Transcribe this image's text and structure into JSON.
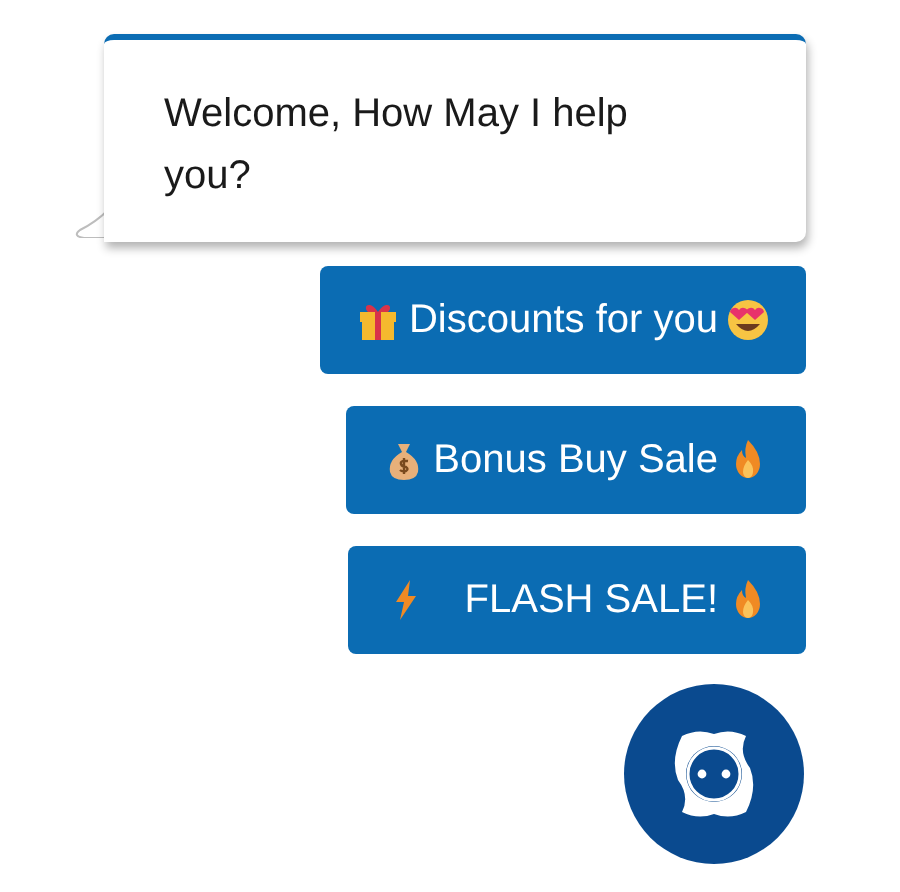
{
  "message": {
    "text": "Welcome, How May I help you?"
  },
  "quick_replies": [
    {
      "label": "Discounts for you",
      "lead": {
        "kind": "gift"
      },
      "trail": {
        "kind": "heart-eyes"
      }
    },
    {
      "label": "Bonus Buy Sale",
      "lead": {
        "kind": "money-bag"
      },
      "trail": {
        "kind": "fire"
      }
    },
    {
      "label": "FLASH SALE!",
      "lead": {
        "kind": "bolt"
      },
      "trail": {
        "kind": "fire"
      }
    }
  ]
}
